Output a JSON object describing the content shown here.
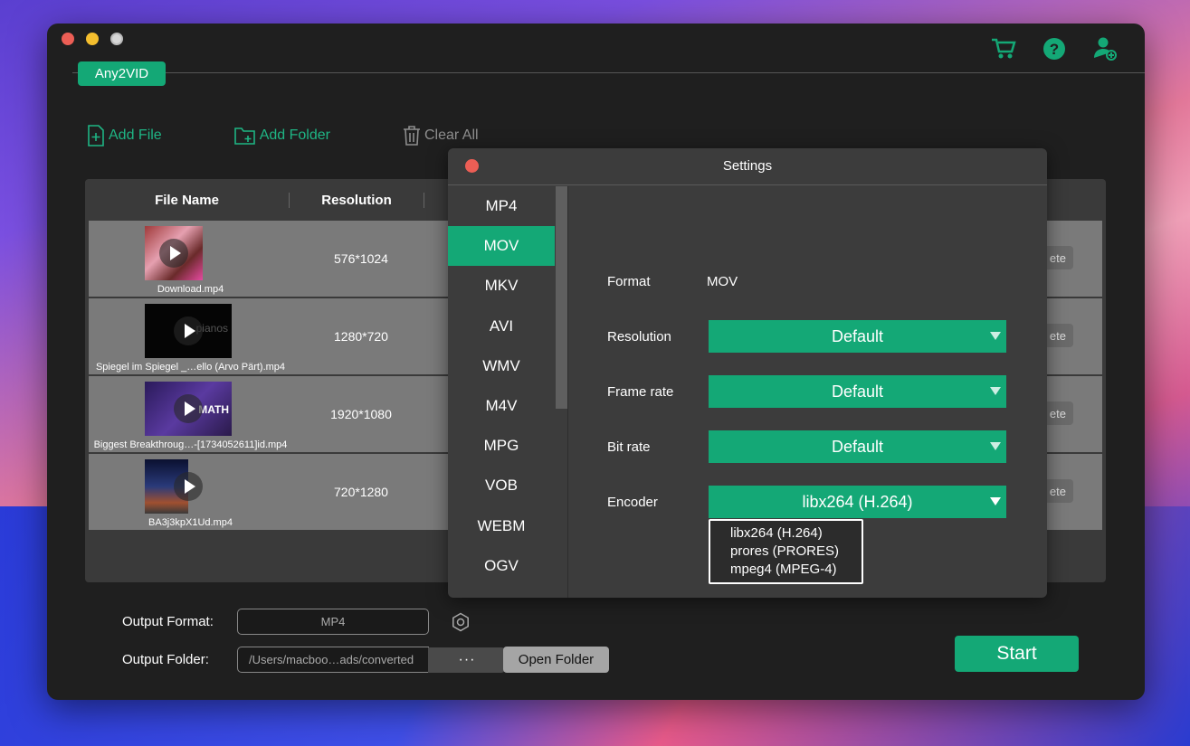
{
  "app": {
    "tab_label": "Any2VID"
  },
  "toolbar": {
    "add_file": "Add File",
    "add_folder": "Add Folder",
    "clear_all": "Clear All"
  },
  "table": {
    "headers": [
      "File Name",
      "Resolution"
    ],
    "rows": [
      {
        "file_name": "Download.mp4",
        "resolution": "576*1024",
        "action": "ete"
      },
      {
        "file_name": "Spiegel im Spiegel _…ello (Arvo Pärt).mp4",
        "resolution": "1280*720",
        "action": "ete"
      },
      {
        "file_name": "Biggest Breakthroug…-[1734052611]id.mp4",
        "resolution": "1920*1080",
        "action": "ete"
      },
      {
        "file_name": "BA3j3kpX1Ud.mp4",
        "resolution": "720*1280",
        "action": "ete"
      }
    ],
    "thumb_text": [
      "",
      "pianos",
      "MATH",
      ""
    ]
  },
  "output": {
    "format_label": "Output Format:",
    "format_value": "MP4",
    "folder_label": "Output Folder:",
    "folder_value": "/Users/macboo…ads/converted",
    "browse_label": "···",
    "open_folder": "Open Folder",
    "start": "Start"
  },
  "settings": {
    "title": "Settings",
    "formats": [
      "MP4",
      "MOV",
      "MKV",
      "AVI",
      "WMV",
      "M4V",
      "MPG",
      "VOB",
      "WEBM",
      "OGV"
    ],
    "selected_format": "MOV",
    "format_label": "Format",
    "format_value": "MOV",
    "resolution_label": "Resolution",
    "resolution_value": "Default",
    "frame_rate_label": "Frame rate",
    "frame_rate_value": "Default",
    "bit_rate_label": "Bit rate",
    "bit_rate_value": "Default",
    "encoder_label": "Encoder",
    "encoder_value": "libx264 (H.264)",
    "encoder_options": [
      "libx264 (H.264)",
      "prores (PRORES)",
      "mpeg4 (MPEG-4)"
    ]
  },
  "colors": {
    "accent": "#14a876",
    "window_bg": "#1f1f1f",
    "row_bg": "#7a7a7a"
  }
}
